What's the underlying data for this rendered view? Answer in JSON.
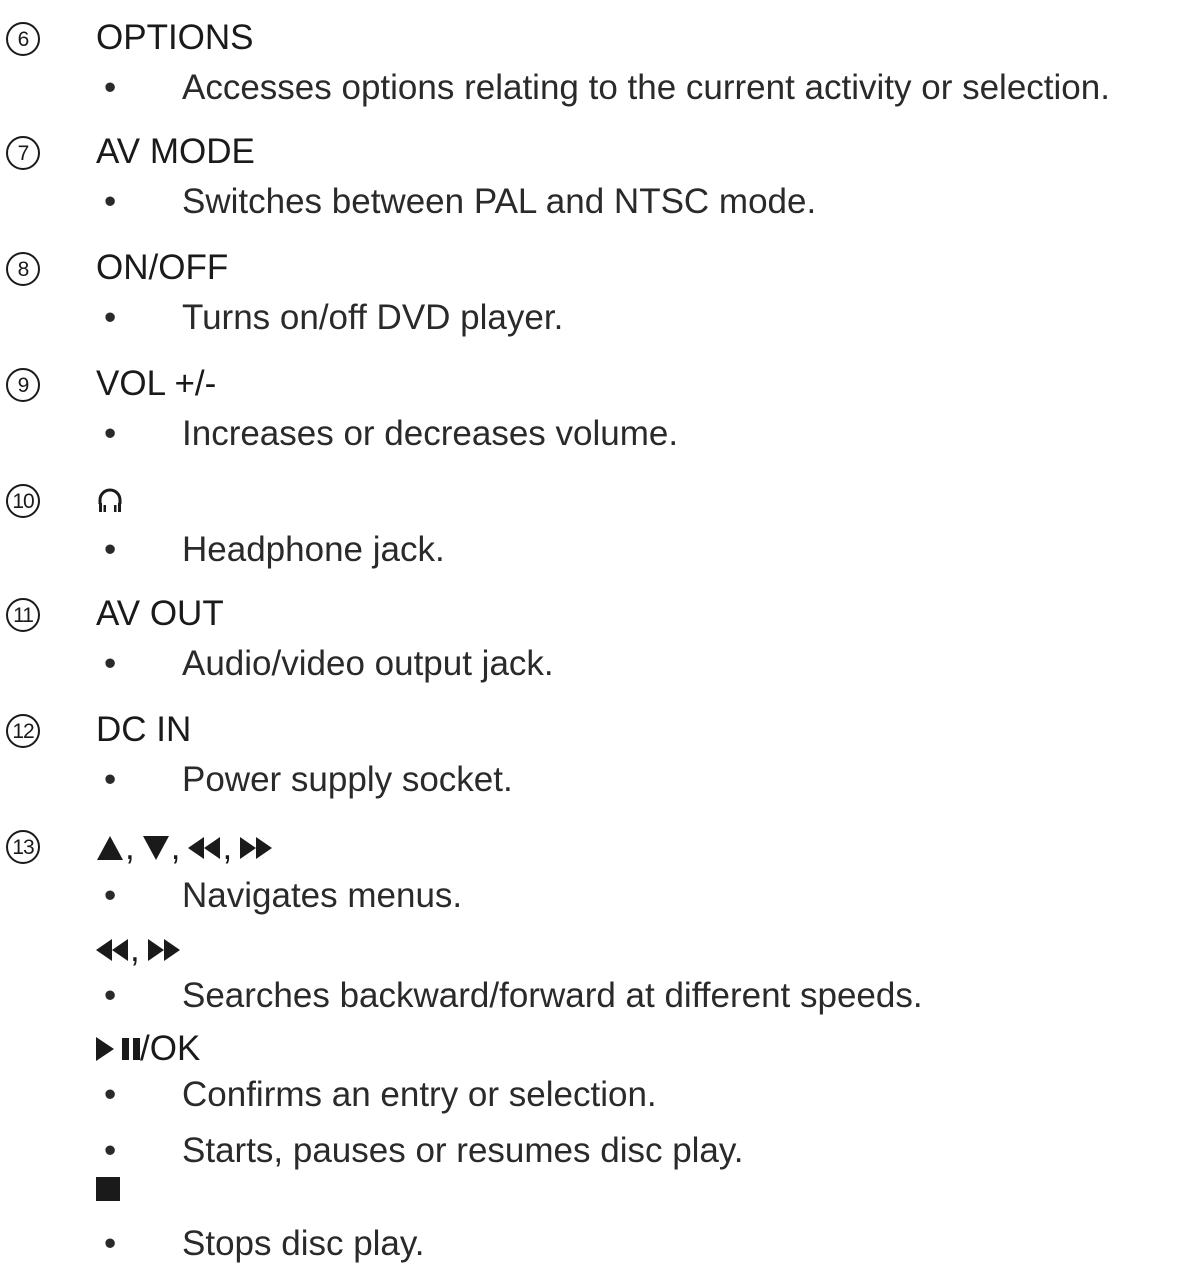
{
  "entries": [
    {
      "number": "6",
      "heading": "OPTIONS",
      "bullets": [
        "Accesses options relating to the current activity or selection."
      ]
    },
    {
      "number": "7",
      "heading": "AV MODE",
      "bullets": [
        "Switches between PAL and NTSC mode."
      ]
    },
    {
      "number": "8",
      "heading": "ON/OFF",
      "bullets": [
        "Turns on/off DVD player."
      ]
    },
    {
      "number": "9",
      "heading": "VOL +/-",
      "bullets": [
        "Increases or decreases volume."
      ]
    },
    {
      "number": "10",
      "heading_icon": "headphone-icon",
      "bullets": [
        "Headphone jack."
      ]
    },
    {
      "number": "11",
      "heading": "AV OUT",
      "bullets": [
        "Audio/video output jack."
      ]
    },
    {
      "number": "12",
      "heading": "DC IN",
      "bullets": [
        "Power supply socket."
      ]
    },
    {
      "number": "13",
      "heading_icons": [
        "up-triangle-icon",
        "down-triangle-icon",
        "rewind-icon",
        "fast-forward-icon"
      ],
      "bullets": [
        "Navigates menus."
      ],
      "sub_items": [
        {
          "icons": [
            "rewind-icon",
            "fast-forward-icon"
          ],
          "bullets": [
            "Searches backward/forward at different speeds."
          ]
        },
        {
          "icons": [
            "play-pause-icon"
          ],
          "label": "/OK",
          "bullets": [
            "Confirms an entry or selection.",
            "Starts, pauses or resumes disc play."
          ]
        },
        {
          "icons": [
            "stop-icon"
          ],
          "bullets": [
            "Stops disc play."
          ]
        }
      ]
    }
  ],
  "bullet_char": "•",
  "separator": ","
}
